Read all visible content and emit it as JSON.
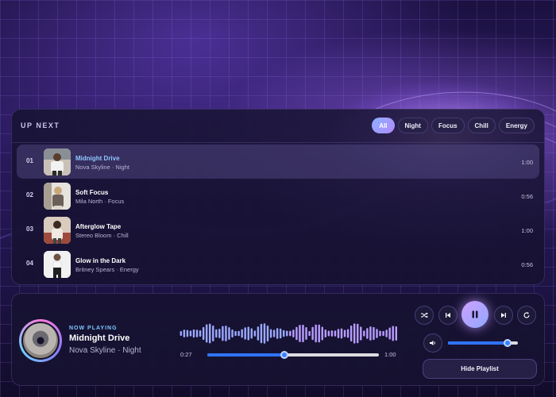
{
  "playlist": {
    "title": "UP NEXT",
    "filters": [
      {
        "label": "All",
        "active": true
      },
      {
        "label": "Night",
        "active": false
      },
      {
        "label": "Focus",
        "active": false
      },
      {
        "label": "Chill",
        "active": false
      },
      {
        "label": "Energy",
        "active": false
      }
    ],
    "tracks": [
      {
        "num": "01",
        "title": "Midnight Drive",
        "subtitle": "Nova Skyline · Night",
        "duration": "1:00",
        "active": true
      },
      {
        "num": "02",
        "title": "Soft Focus",
        "subtitle": "Mila North · Focus",
        "duration": "0:56",
        "active": false
      },
      {
        "num": "03",
        "title": "Afterglow Tape",
        "subtitle": "Stereo Bloom · Chill",
        "duration": "1:00",
        "active": false
      },
      {
        "num": "04",
        "title": "Glow in the Dark",
        "subtitle": "Britney Spears · Energy",
        "duration": "0:56",
        "active": false
      }
    ]
  },
  "player": {
    "label": "NOW PLAYING",
    "title": "Midnight Drive",
    "artist": "Nova Skyline · Night",
    "current_time": "0:27",
    "total_time": "1:00",
    "progress": 0.45,
    "volume": 0.85,
    "hide_playlist_label": "Hide Playlist",
    "controls": [
      "shuffle-icon",
      "previous-icon",
      "pause-icon",
      "next-icon",
      "repeat-icon",
      "volume-icon"
    ]
  },
  "colors": {
    "accent": "#8fc6ff",
    "progress": "#2f74ff",
    "play_gradient_start": "#cfa0ff",
    "play_gradient_end": "#8fa8ff"
  }
}
